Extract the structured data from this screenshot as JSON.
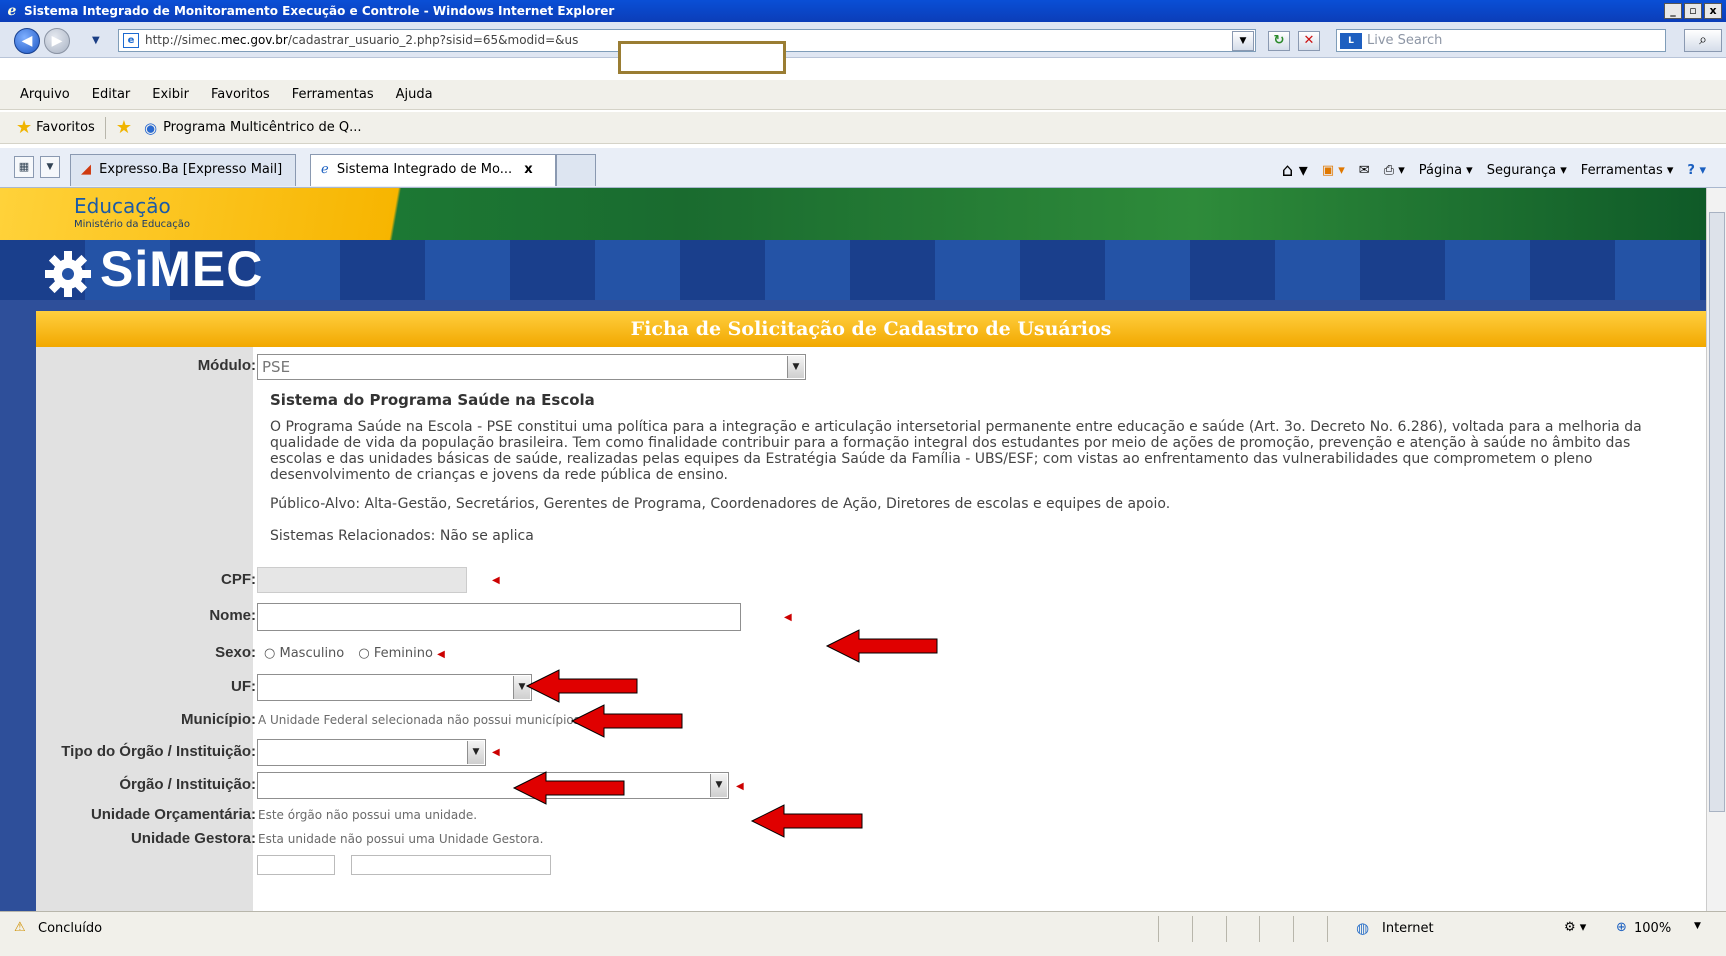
{
  "window": {
    "title": "Sistema Integrado de Monitoramento Execução e Controle - Windows Internet Explorer",
    "controls": [
      "_",
      "▫",
      "x"
    ]
  },
  "address_bar": {
    "url_prefix": "http://simec.",
    "url_domain": "mec.gov.br",
    "url_path": "/cadastrar_usuario_2.php?sisid=65&modid=&us",
    "search_placeholder": "Live Search"
  },
  "menu": [
    "Arquivo",
    "Editar",
    "Exibir",
    "Favoritos",
    "Ferramentas",
    "Ajuda"
  ],
  "favorites": {
    "label": "Favoritos",
    "item": "Programa Multicêntrico de Q..."
  },
  "tabs": [
    {
      "label": "Expresso.Ba [Expresso Mail]"
    },
    {
      "label": "Sistema Integrado de Mo...",
      "close": "x"
    }
  ],
  "command_bar": [
    "Página",
    "Segurança",
    "Ferramentas"
  ],
  "site": {
    "ministry_title": "Educação",
    "ministry_sub": "Ministério da Educação",
    "logo": "SiMEC"
  },
  "form": {
    "header": "Ficha de Solicitação de Cadastro de Usuários",
    "modulo_label": "Módulo:",
    "modulo_value": "PSE",
    "system_title": "Sistema do Programa Saúde na Escola",
    "system_description": "O Programa Saúde na Escola - PSE constitui uma política para a integração e articulação intersetorial permanente entre educação e saúde (Art. 3o. Decreto No. 6.286), voltada para a melhoria da qualidade de vida da população brasileira. Tem como finalidade contribuir para a formação integral dos estudantes por meio de ações de promoção, prevenção e atenção à saúde no âmbito das escolas e das unidades básicas de saúde, realizadas pelas equipes da Estratégia Saúde da Família - UBS/ESF; com vistas ao enfrentamento das vulnerabilidades que comprometem o pleno desenvolvimento de crianças e jovens da rede pública de ensino.",
    "publico_label": "Público-Alvo:",
    "publico_value": "Alta-Gestão, Secretários, Gerentes de Programa, Coordenadores de Ação, Diretores de escolas e equipes de apoio.",
    "sistemas_label": "Sistemas Relacionados:",
    "sistemas_value": "Não se aplica",
    "cpf_label": "CPF:",
    "nome_label": "Nome:",
    "sexo_label": "Sexo:",
    "sexo_options": [
      "Masculino",
      "Feminino"
    ],
    "uf_label": "UF:",
    "municipio_label": "Município:",
    "municipio_info": "A Unidade Federal selecionada não possui municípios.",
    "tipo_orgao_label": "Tipo do Órgão / Instituição:",
    "orgao_label": "Órgão / Instituição:",
    "unidade_orc_label": "Unidade Orçamentária:",
    "unidade_orc_info": "Este órgão não possui uma unidade.",
    "unidade_gestora_label": "Unidade Gestora:",
    "unidade_gestora_info": "Esta unidade não possui uma Unidade Gestora."
  },
  "status_bar": {
    "status": "Concluído",
    "zone": "Internet",
    "zoom": "100%"
  },
  "colors": {
    "annotation_arrow": "#e00000",
    "form_header": "#f2a800",
    "required": "#cc0000"
  }
}
